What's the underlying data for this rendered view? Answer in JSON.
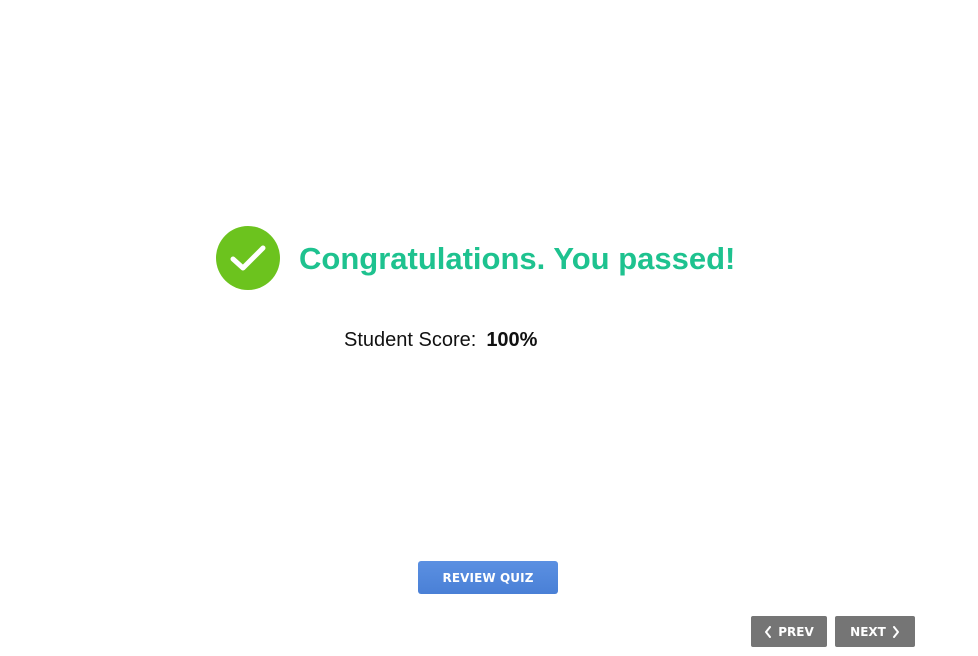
{
  "result": {
    "headline": "Congratulations. You passed!",
    "icon": "check-circle-icon",
    "headline_color": "#1ec28f",
    "icon_color": "#6cc31e"
  },
  "score": {
    "label": "Student Score:",
    "value": "100%"
  },
  "actions": {
    "review_label": "REVIEW QUIZ",
    "review_color": "#4a80d6"
  },
  "navigation": {
    "prev_label": "PREV",
    "next_label": "NEXT",
    "prev_icon": "chevron-left-icon",
    "next_icon": "chevron-right-icon",
    "button_color": "#757575"
  }
}
